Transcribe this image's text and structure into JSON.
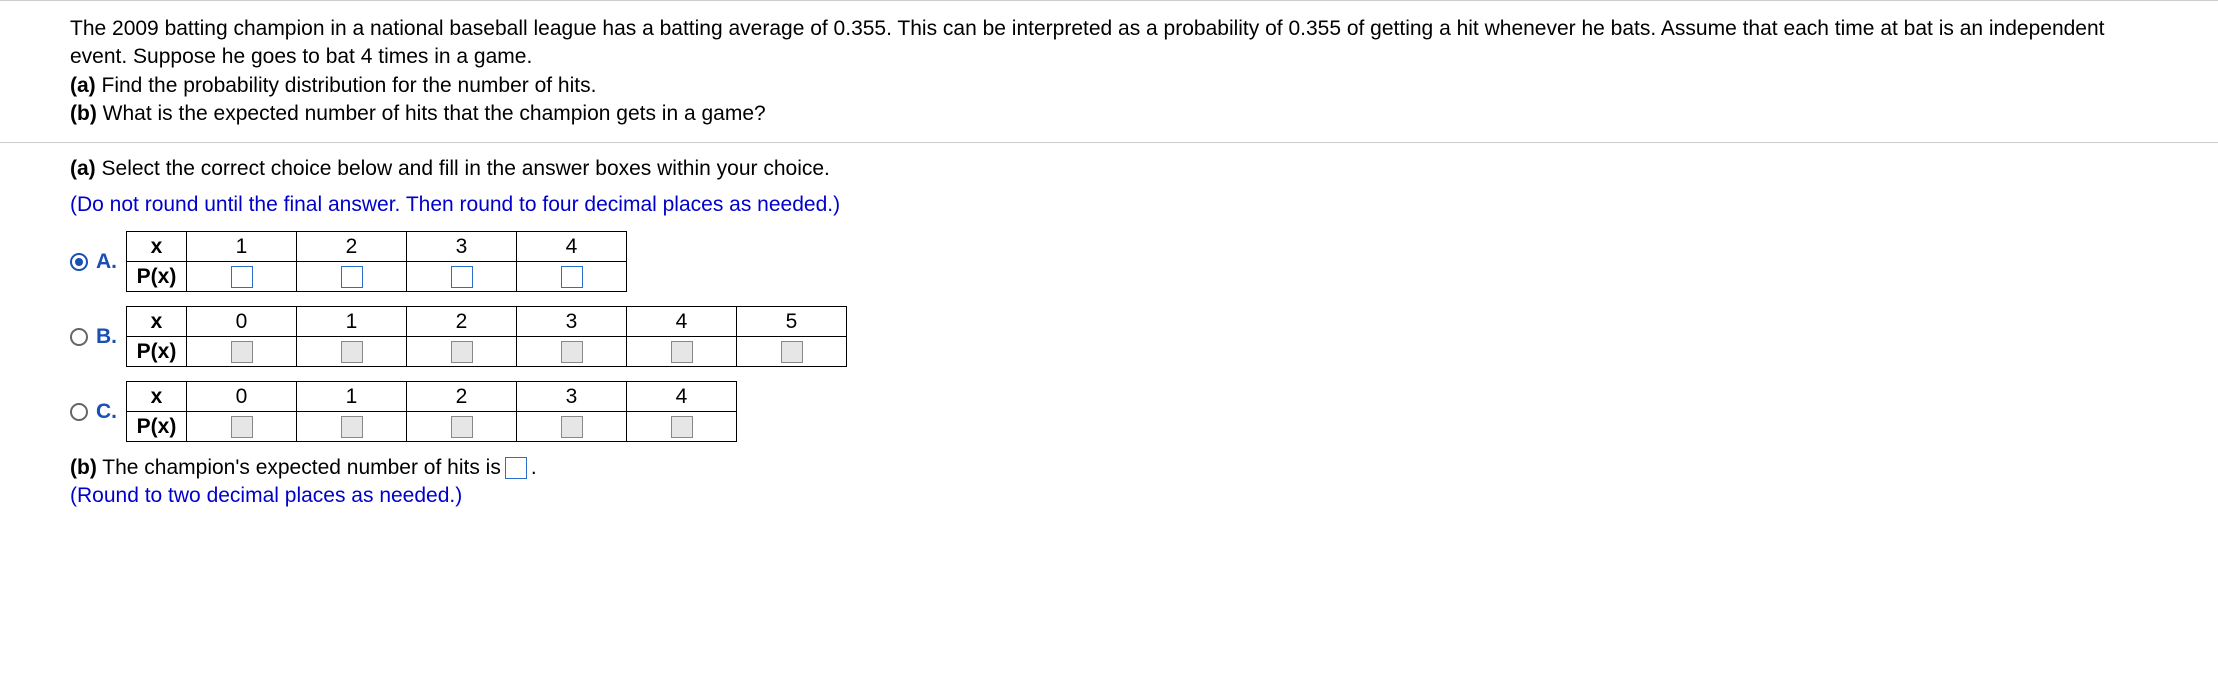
{
  "question": {
    "intro": "The 2009 batting champion in a national baseball league has a batting average of 0.355. This can be interpreted as a probability of 0.355 of getting a hit whenever he bats. Assume that each time at bat is an independent event. Suppose he goes to bat 4 times in a game.",
    "part_a_label": "(a)",
    "part_a_text": " Find the probability distribution for the number of hits.",
    "part_b_label": "(b)",
    "part_b_text": " What is the expected number of hits that the champion gets in a game?"
  },
  "partA": {
    "header_label": "(a)",
    "header_text": " Select the correct choice below and fill in the answer boxes within your choice.",
    "instruction": "(Do not round until the final answer. Then round to four decimal places as needed.)",
    "row_label_x": "x",
    "row_label_px": "P(x)",
    "choices": [
      {
        "letter": "A.",
        "selected": true,
        "x_values": [
          "1",
          "2",
          "3",
          "4"
        ]
      },
      {
        "letter": "B.",
        "selected": false,
        "x_values": [
          "0",
          "1",
          "2",
          "3",
          "4",
          "5"
        ]
      },
      {
        "letter": "C.",
        "selected": false,
        "x_values": [
          "0",
          "1",
          "2",
          "3",
          "4"
        ]
      }
    ]
  },
  "partB": {
    "label": "(b)",
    "text_before": " The champion's expected number of hits is ",
    "text_after": ".",
    "round_note": "(Round to two decimal places as needed.)"
  }
}
